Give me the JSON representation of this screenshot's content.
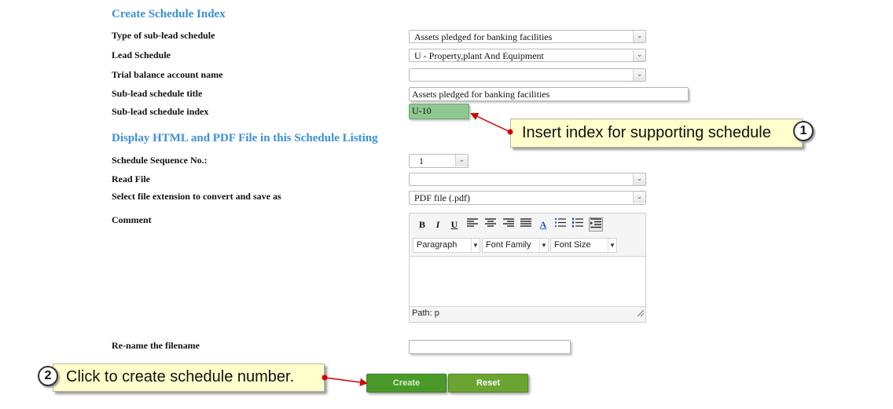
{
  "form": {
    "heading": "Create Schedule Index",
    "type_label": "Type of sub-lead schedule",
    "type_value": "Assets pledged for banking facilities",
    "lead_label": "Lead Schedule",
    "lead_value": "U - Property,plant And Equipment",
    "trial_label": "Trial balance account name",
    "trial_value": "",
    "title_label": "Sub-lead schedule title",
    "title_value": "Assets pledged for banking facilities",
    "index_label": "Sub-lead schedule index",
    "index_value": "U-10"
  },
  "display": {
    "heading": "Display HTML and PDF File in this Schedule Listing",
    "seq_label": "Schedule Sequence No.:",
    "seq_value": "1",
    "read_label": "Read File",
    "read_value": "",
    "ext_label": "Select file extension to convert and save as",
    "ext_value": "PDF file (.pdf)",
    "comment_label": "Comment",
    "rename_label": "Re-name the filename",
    "rename_value": ""
  },
  "editor": {
    "toolbar": {
      "bold": "B",
      "italic": "I",
      "underline": "U",
      "font_color": "A"
    },
    "format_select": "Paragraph",
    "font_family_select": "Font Family",
    "font_size_select": "Font Size",
    "status_path": "Path: p"
  },
  "buttons": {
    "create": "Create",
    "reset": "Reset"
  },
  "callouts": {
    "one_text": "Insert index for supporting schedule",
    "one_num": "1",
    "two_text": "Click to create schedule number.",
    "two_num": "2"
  },
  "colors": {
    "heading": "#3c8fd8",
    "index_highlight": "#8fc790",
    "create_button": "#4a9a2a",
    "reset_button": "#6aa531",
    "callout_bg": "#ffffcc",
    "arrow": "#d40000"
  }
}
